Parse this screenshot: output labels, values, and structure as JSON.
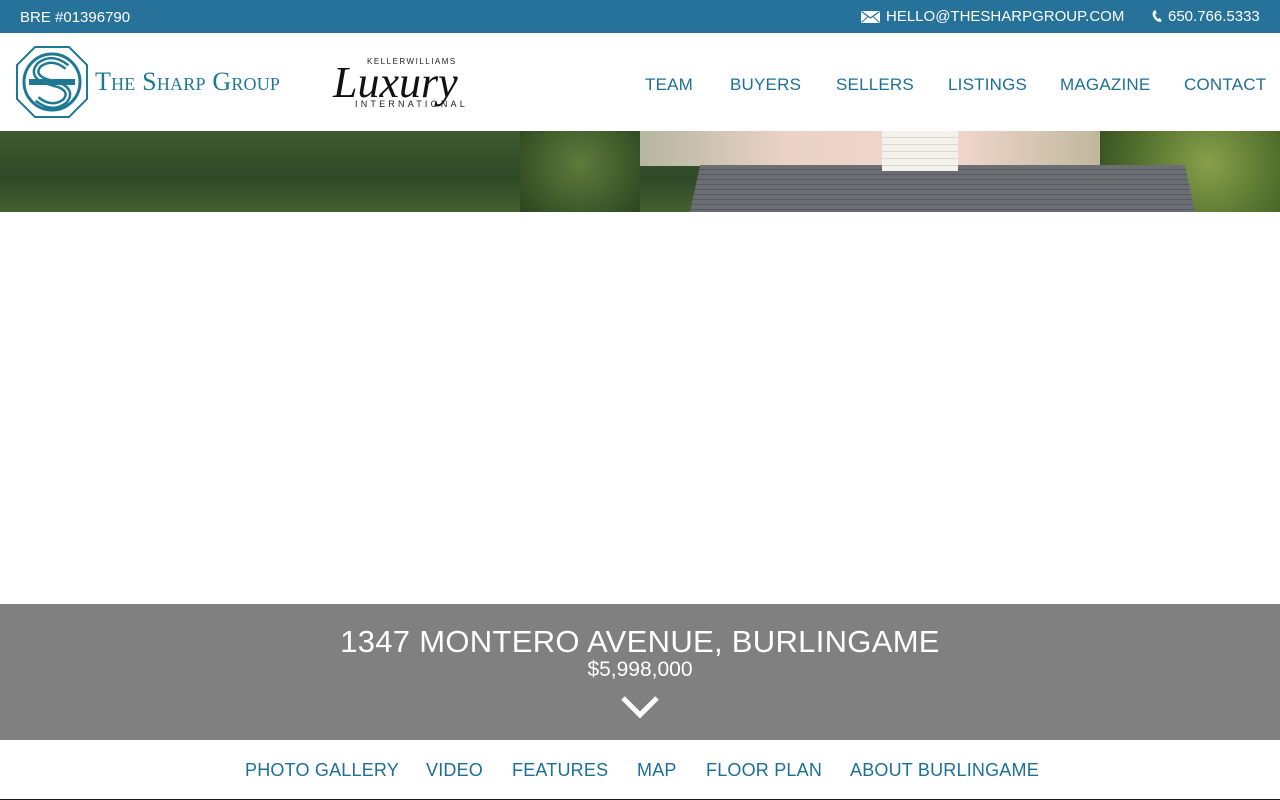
{
  "topbar": {
    "license": "BRE #01396790",
    "email": "HELLO@THESHARPGROUP.COM",
    "phone": "650.766.5333",
    "email_icon": "envelope-icon",
    "phone_icon": "phone-icon"
  },
  "brand": {
    "name": "The Sharp Group",
    "partner_top": "KELLERWILLIAMS",
    "partner_main": "Luxury",
    "partner_bottom": "INTERNATIONAL",
    "color": "#1e7a94"
  },
  "nav": {
    "items": [
      {
        "label": "TEAM"
      },
      {
        "label": "BUYERS"
      },
      {
        "label": "SELLERS"
      },
      {
        "label": "LISTINGS"
      },
      {
        "label": "MAGAZINE"
      },
      {
        "label": "CONTACT"
      }
    ]
  },
  "listing": {
    "address": "1347 MONTERO AVENUE, BURLINGAME",
    "price": "$5,998,000",
    "scroll_icon": "chevron-down-icon"
  },
  "subnav": {
    "items": [
      {
        "label": "PHOTO GALLERY"
      },
      {
        "label": "VIDEO"
      },
      {
        "label": "FEATURES"
      },
      {
        "label": "MAP"
      },
      {
        "label": "FLOOR PLAN"
      },
      {
        "label": "ABOUT BURLINGAME"
      }
    ]
  },
  "colors": {
    "topbar": "#27729b",
    "link": "#1c6f98",
    "band": "#808080"
  }
}
